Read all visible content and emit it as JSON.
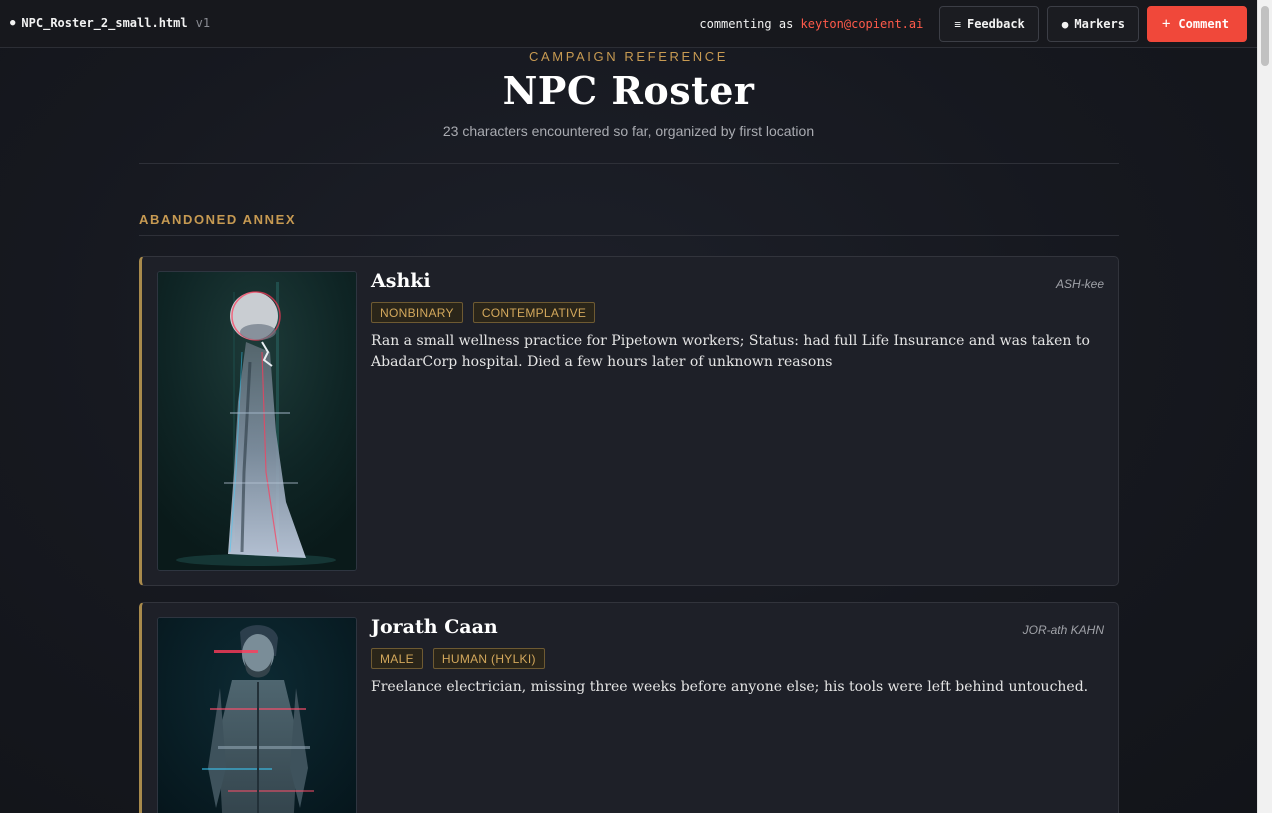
{
  "topbar": {
    "filename": "NPC_Roster_2_small.html",
    "version": "v1",
    "commenting_prefix": "commenting as",
    "user": "keyton@copient.ai",
    "feedback_label": "Feedback",
    "markers_label": "Markers",
    "comment_label": "Comment",
    "feedback_icon": "≡",
    "markers_icon": "●",
    "comment_icon": "+"
  },
  "header": {
    "eyebrow": "CAMPAIGN REFERENCE",
    "title": "NPC Roster",
    "subtitle": "23 characters encountered so far, organized by first location"
  },
  "section": {
    "label": "ABANDONED ANNEX"
  },
  "npcs": [
    {
      "name": "Ashki",
      "pronunciation": "ASH-kee",
      "tags": [
        "NONBINARY",
        "CONTEMPLATIVE"
      ],
      "description": "Ran a small wellness practice for Pipetown workers; Status: had full Life Insurance and was taken to AbadarCorp hospital. Died a few hours later of unknown reasons",
      "portrait_icon": "hooded-figure-portrait"
    },
    {
      "name": "Jorath Caan",
      "pronunciation": "JOR-ath KAHN",
      "tags": [
        "MALE",
        "HUMAN (HYLKI)"
      ],
      "description": "Freelance electrician, missing three weeks before anyone else; his tools were left behind untouched.",
      "portrait_icon": "man-glitch-portrait"
    }
  ],
  "colors": {
    "accent_gold": "#c79a52",
    "comment_red": "#f0483a",
    "user_red": "#ff5a4a",
    "card_bg": "#1e2028",
    "page_bg": "#16181f"
  }
}
